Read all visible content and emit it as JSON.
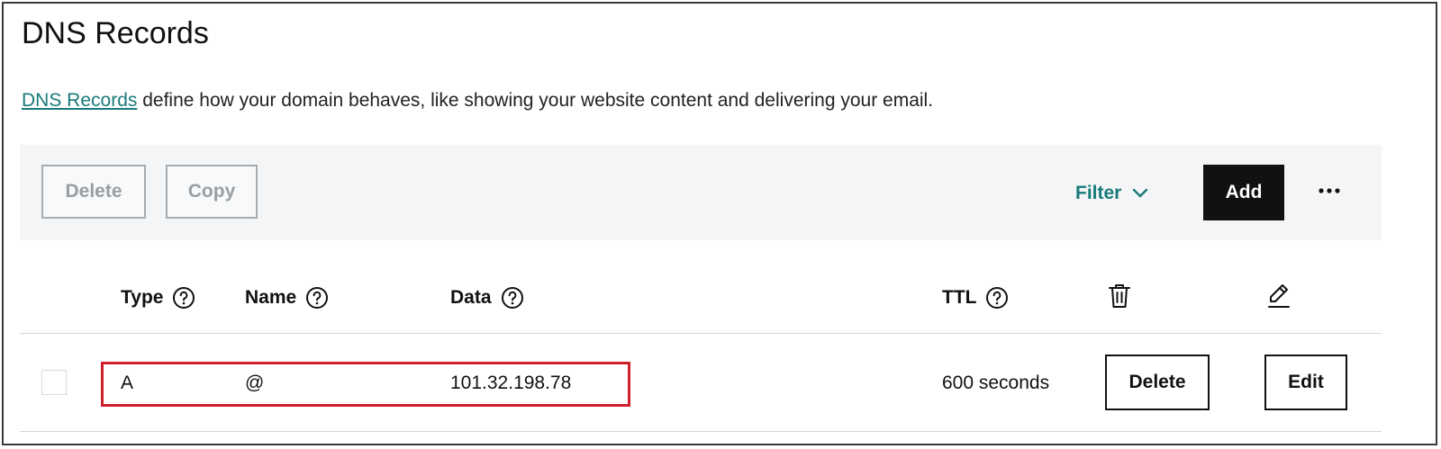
{
  "page": {
    "title": "DNS Records",
    "description_link": "DNS Records",
    "description_rest": " define how your domain behaves, like showing your website content and delivering your email."
  },
  "toolbar": {
    "delete_label": "Delete",
    "copy_label": "Copy",
    "filter_label": "Filter",
    "add_label": "Add",
    "more_icon": "more-horizontal-icon"
  },
  "table": {
    "columns": [
      {
        "label": "Type",
        "help_icon": "question-circle-icon"
      },
      {
        "label": "Name",
        "help_icon": "question-circle-icon"
      },
      {
        "label": "Data",
        "help_icon": "question-circle-icon"
      },
      {
        "label": "TTL",
        "help_icon": "question-circle-icon"
      }
    ],
    "action_icons": [
      "trash-icon",
      "pencil-icon"
    ],
    "rows": [
      {
        "type": "A",
        "name": "@",
        "data": "101.32.198.78",
        "ttl": "600 seconds",
        "delete_label": "Delete",
        "edit_label": "Edit"
      }
    ]
  },
  "colors": {
    "accent_teal": "#1a7a7a",
    "highlight_red": "#d0202e",
    "primary_button": "#111111",
    "toolbar_bg": "#f4f5f6"
  }
}
